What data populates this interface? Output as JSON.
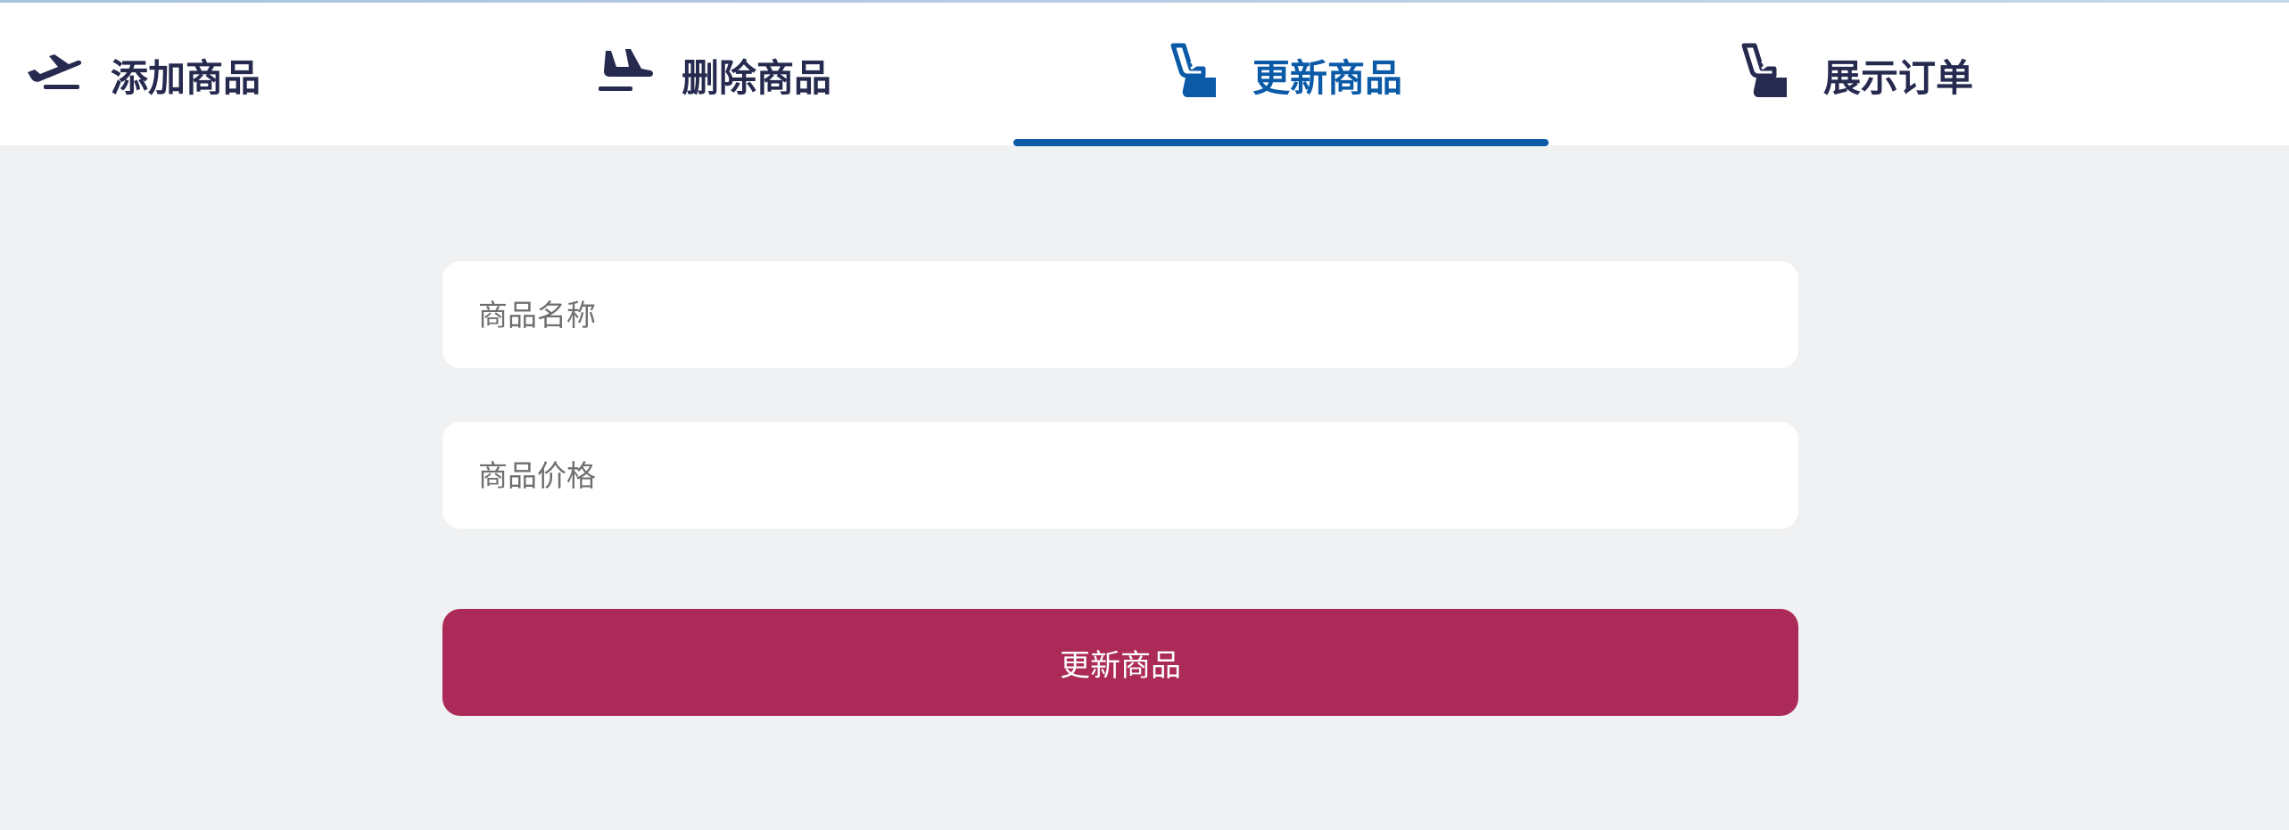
{
  "tabs": [
    {
      "label": "添加商品",
      "icon": "plane-departure-icon"
    },
    {
      "label": "删除商品",
      "icon": "plane-arrival-icon"
    },
    {
      "label": "更新商品",
      "icon": "seat-icon",
      "active": true
    },
    {
      "label": "展示订单",
      "icon": "seat-icon"
    }
  ],
  "form": {
    "name_placeholder": "商品名称",
    "price_placeholder": "商品价格",
    "submit_label": "更新商品"
  },
  "colors": {
    "active": "#0a5aa8",
    "inactive": "#262a4f",
    "button": "#ab2a57",
    "background": "#f0f1f3"
  }
}
